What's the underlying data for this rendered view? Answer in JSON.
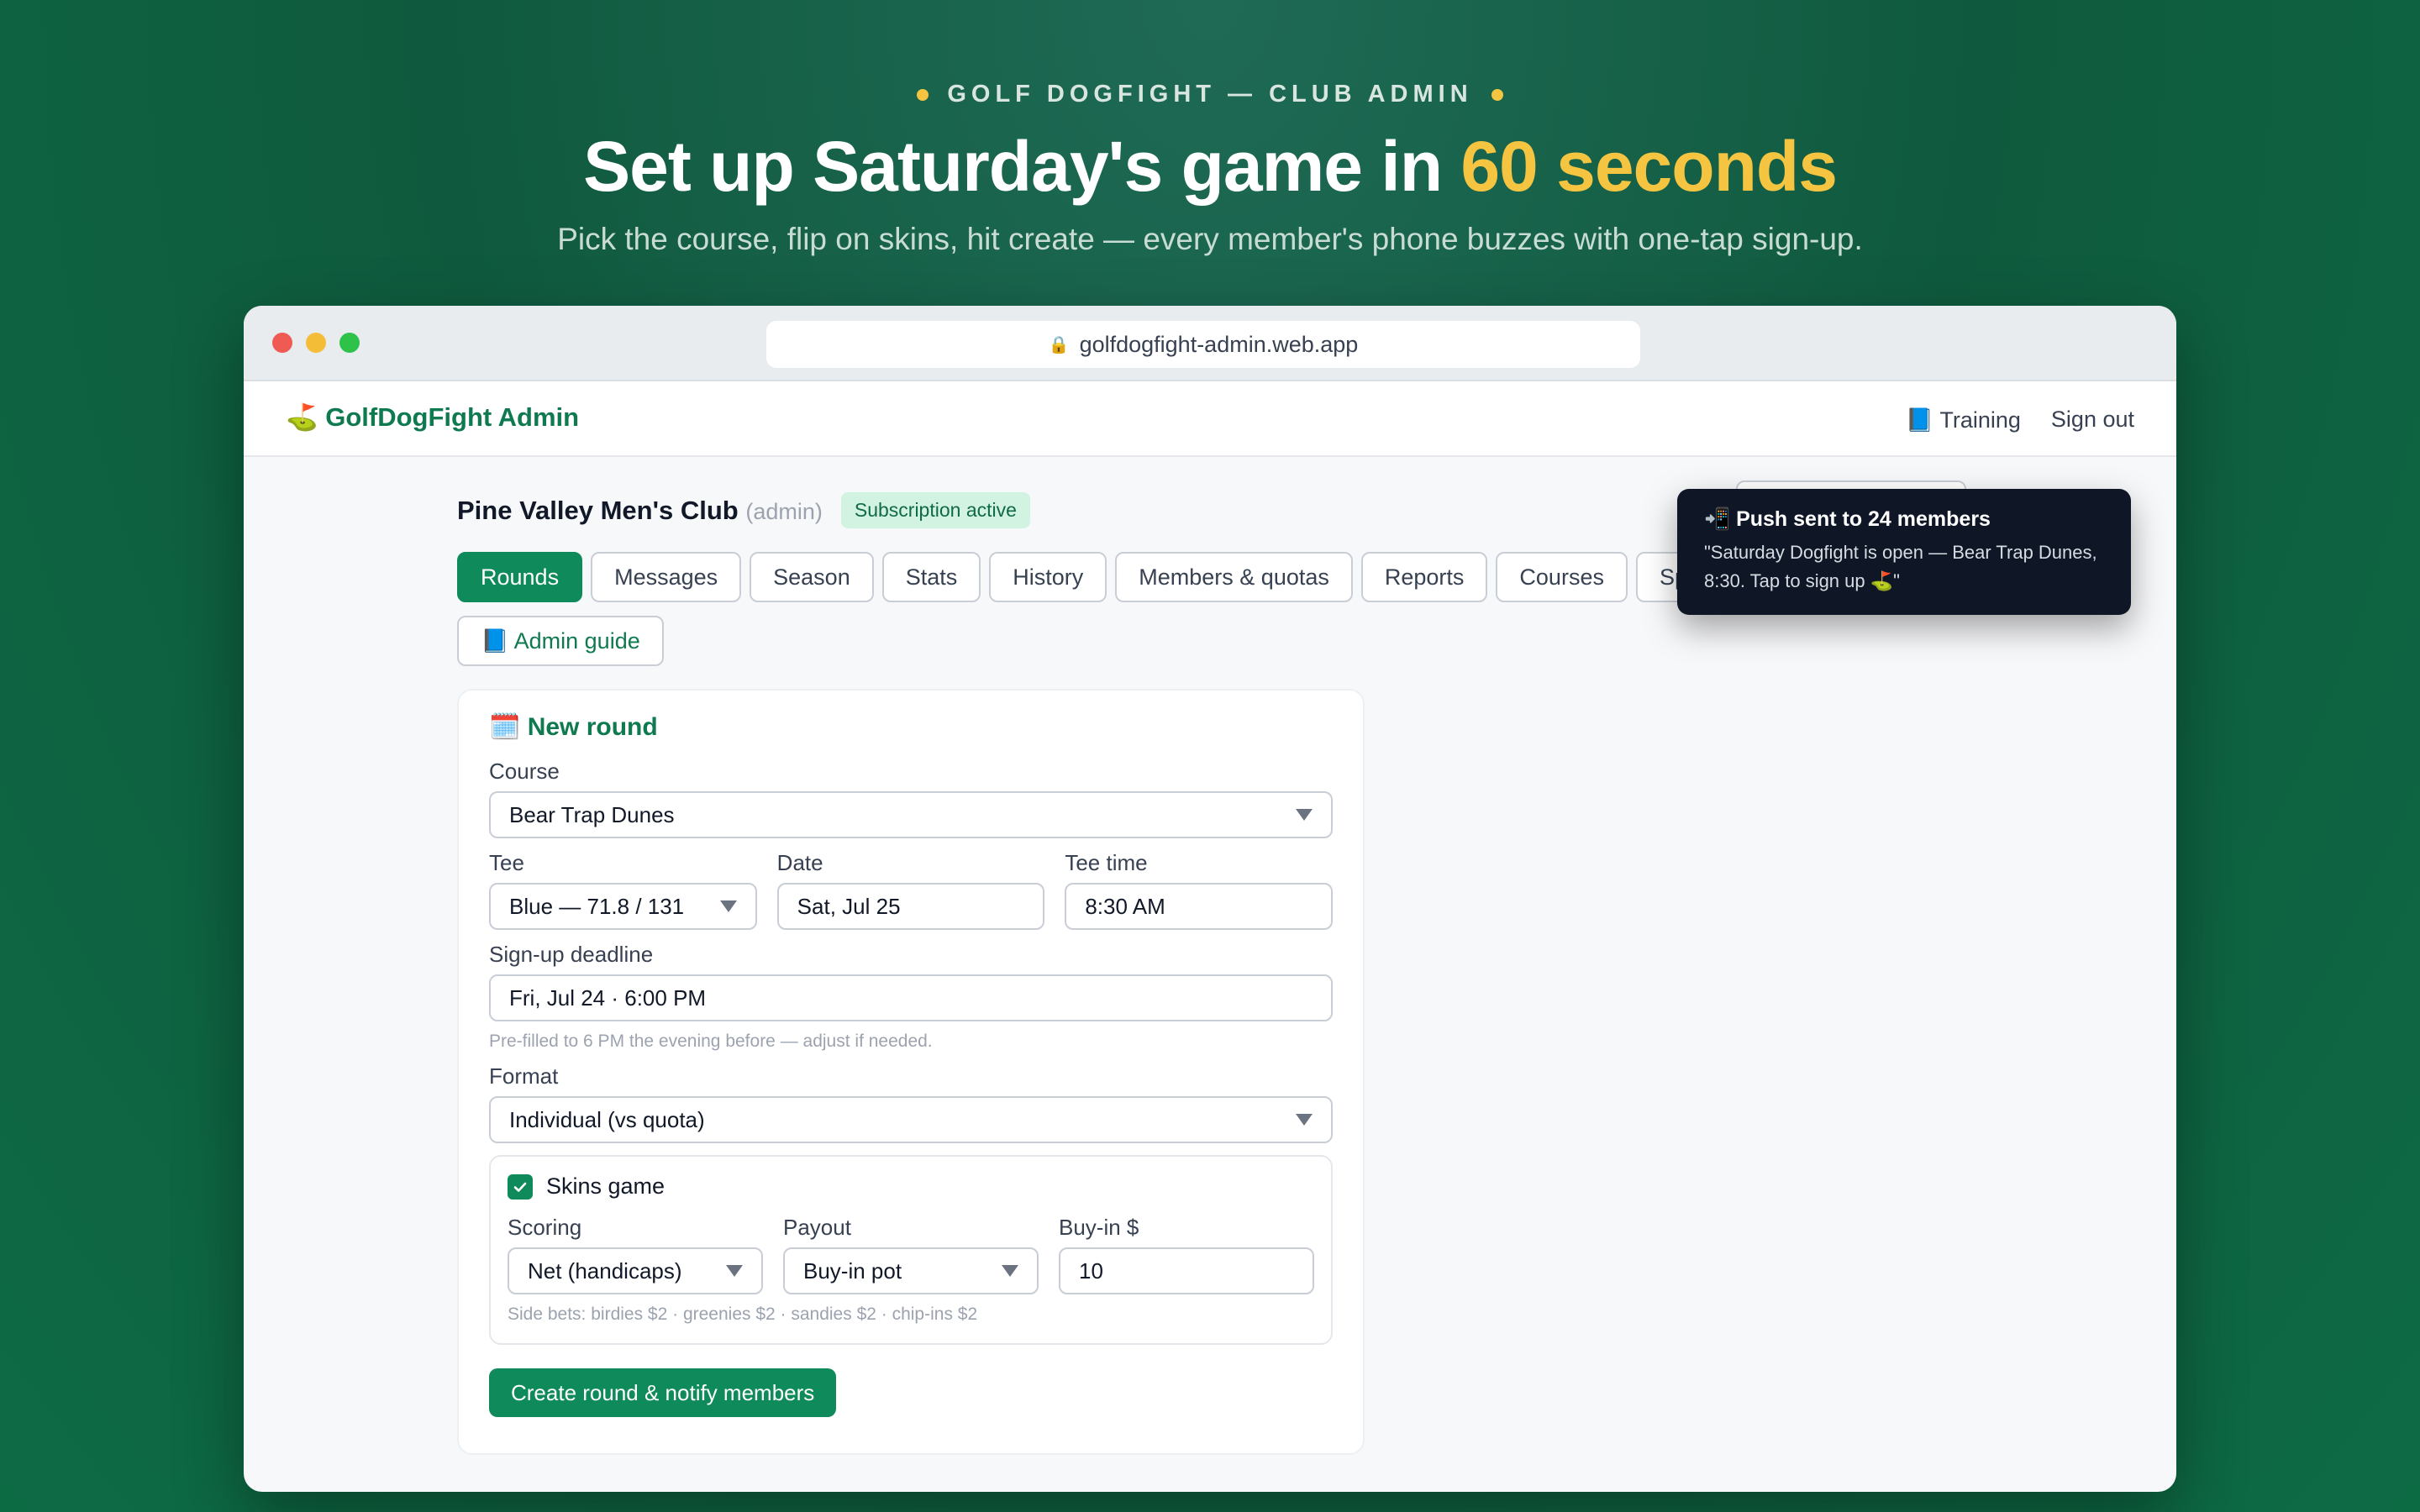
{
  "hero": {
    "eyebrow": "GOLF DOGFIGHT — CLUB ADMIN",
    "headline_main": "Set up Saturday's game in ",
    "headline_accent": "60 seconds",
    "subline": "Pick the course, flip on skins, hit create — every member's phone buzzes with one-tap sign-up."
  },
  "browser": {
    "url": "golfdogfight-admin.web.app"
  },
  "appbar": {
    "brand": "⛳ GolfDogFight Admin",
    "training": "📘 Training",
    "sign_out": "Sign out"
  },
  "club": {
    "name": "Pine Valley Men's Club",
    "role": "(admin)",
    "subscription": "Subscription active"
  },
  "tabs": {
    "rounds": "Rounds",
    "messages": "Messages",
    "season": "Season",
    "stats": "Stats",
    "history": "History",
    "members": "Members & quotas",
    "reports": "Reports",
    "courses": "Courses",
    "sponsors": "Spo",
    "guide": "📘 Admin guide"
  },
  "toast": {
    "title": "📲 Push sent to 24 members",
    "body": "\"Saturday Dogfight is open — Bear Trap Dunes, 8:30. Tap to sign up ⛳\""
  },
  "form": {
    "title": "🗓️ New round",
    "course_label": "Course",
    "course_value": "Bear Trap Dunes",
    "tee_label": "Tee",
    "tee_value": "Blue — 71.8 / 131",
    "date_label": "Date",
    "date_value": "Sat, Jul 25",
    "time_label": "Tee time",
    "time_value": "8:30 AM",
    "deadline_label": "Sign-up deadline",
    "deadline_value": "Fri, Jul 24 · 6:00 PM",
    "deadline_hint": "Pre-filled to 6 PM the evening before — adjust if needed.",
    "format_label": "Format",
    "format_value": "Individual (vs quota)",
    "skins": {
      "label": "Skins game",
      "checked": true,
      "scoring_label": "Scoring",
      "scoring_value": "Net (handicaps)",
      "payout_label": "Payout",
      "payout_value": "Buy-in pot",
      "buyin_label": "Buy-in $",
      "buyin_value": "10",
      "side_bets": "Side bets: birdies $2 · greenies $2 · sandies $2 · chip-ins $2"
    },
    "submit": "Create round & notify members"
  },
  "colors": {
    "accent": "#0f8a5a",
    "highlight": "#f5c542",
    "toast_bg": "#0f1727"
  }
}
